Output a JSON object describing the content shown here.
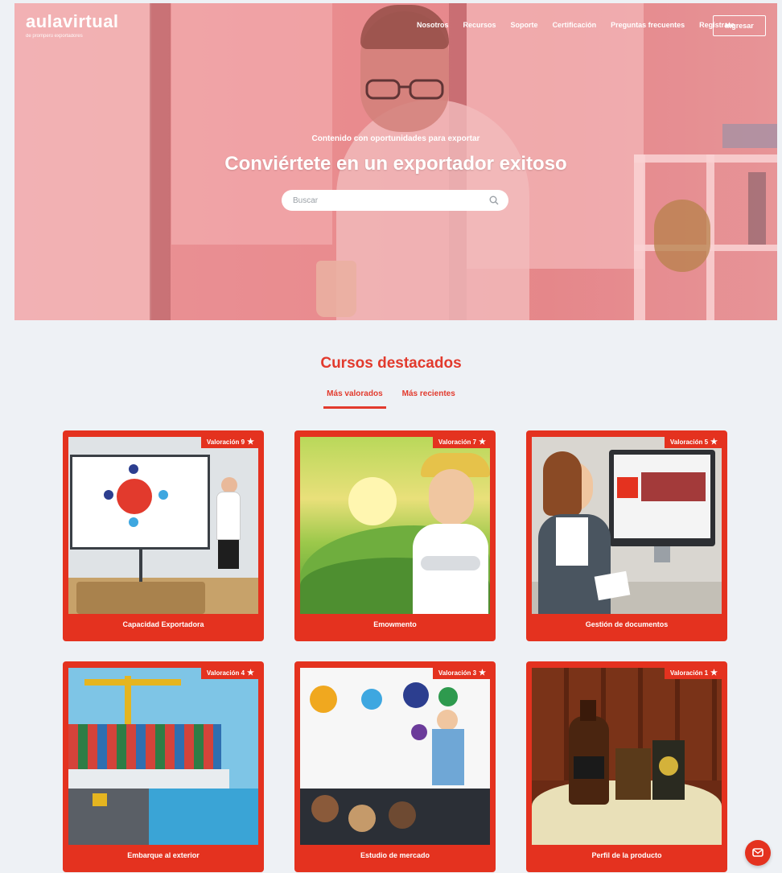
{
  "brand": {
    "logo": "aulavirtual",
    "tagline": "de promperú exportadores"
  },
  "nav": {
    "links": [
      "Nosotros",
      "Recursos",
      "Soporte",
      "Certificación",
      "Preguntas frecuentes",
      "Regístrate"
    ],
    "login_label": "Ingresar"
  },
  "hero": {
    "subtitle": "Contenido con oportunidades para exportar",
    "title": "Conviértete en un exportador exitoso",
    "search_placeholder": "Buscar"
  },
  "featured": {
    "title": "Cursos destacados",
    "tabs": [
      {
        "label": "Más valorados",
        "active": true
      },
      {
        "label": "Más recientes",
        "active": false
      }
    ],
    "courses": [
      {
        "title": "Capacidad Exportadora",
        "rating": "Valoración 9",
        "thumb": "presentation-classroom"
      },
      {
        "title": "Emowmento",
        "rating": "Valoración 7",
        "thumb": "farmer-landscape"
      },
      {
        "title": "Gestión de documentos",
        "rating": "Valoración 5",
        "thumb": "office-computer"
      },
      {
        "title": "Embarque al exterior",
        "rating": "Valoración 4",
        "thumb": "container-port"
      },
      {
        "title": "Estudio de mercado",
        "rating": "Valoración 3",
        "thumb": "audience-diagram"
      },
      {
        "title": "Perfil de la producto",
        "rating": "Valoración 1",
        "thumb": "product-bottles"
      }
    ]
  },
  "colors": {
    "accent": "#e4321f",
    "hero_tint": "#e8a3a6",
    "section_bg": "#eef1f5"
  },
  "icons": {
    "search": "search-icon",
    "star": "star-icon",
    "chat": "chat-icon"
  }
}
